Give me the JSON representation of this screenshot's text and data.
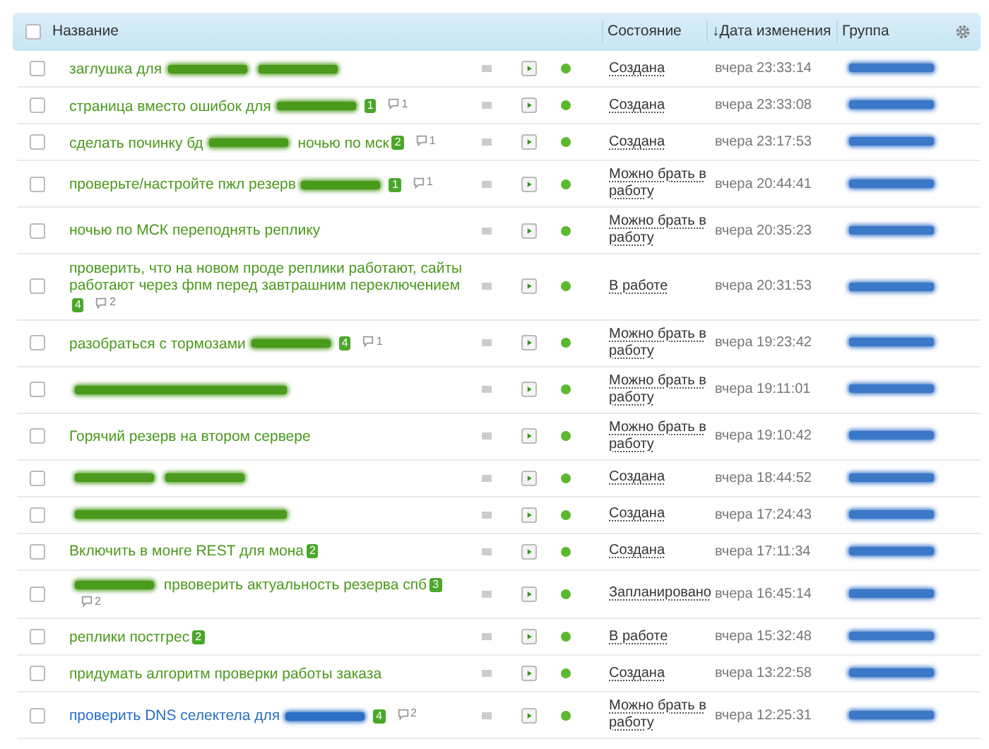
{
  "header": {
    "select_all_checked": false,
    "columns": [
      {
        "kind": "title",
        "label": "Название"
      },
      {
        "kind": "status",
        "label": "Состояние"
      },
      {
        "kind": "date",
        "label": "↓Дата изменения"
      },
      {
        "kind": "group",
        "label": "Группа"
      }
    ]
  },
  "rows": [
    {
      "checked": false,
      "color": "#4a9a1c",
      "title": [
        {
          "kind": "text",
          "text": "заглушка для"
        },
        {
          "kind": "redacted"
        },
        {
          "kind": "redacted"
        }
      ],
      "status_dot": {
        "color": "#5cb82e"
      },
      "status": "Создана",
      "date": "вчера 23:33:14",
      "group": {
        "kind": "redacted"
      }
    },
    {
      "checked": false,
      "color": "#4a9a1c",
      "title": [
        {
          "kind": "text",
          "text": "страница вместо ошибок для"
        },
        {
          "kind": "redacted"
        }
      ],
      "badge": "1",
      "comments": "1",
      "status_dot": {
        "color": "#5cb82e"
      },
      "status": "Создана",
      "date": "вчера 23:33:08",
      "group": {
        "kind": "redacted"
      }
    },
    {
      "checked": false,
      "color": "#4a9a1c",
      "title": [
        {
          "kind": "text",
          "text": "сделать починку бд"
        },
        {
          "kind": "redacted"
        },
        {
          "kind": "text",
          "text": "ночью по мск"
        }
      ],
      "badge": "2",
      "comments": "1",
      "status_dot": {
        "color": "#5cb82e"
      },
      "status": "Создана",
      "date": "вчера 23:17:53",
      "group": {
        "kind": "redacted"
      }
    },
    {
      "checked": false,
      "color": "#4a9a1c",
      "title": [
        {
          "kind": "text",
          "text": "проверьте/настройте пжл резерв"
        },
        {
          "kind": "redacted"
        }
      ],
      "badge": "1",
      "comments": "1",
      "status_dot": {
        "color": "#5cb82e"
      },
      "status": "Можно брать в работу",
      "date": "вчера 20:44:41",
      "group": {
        "kind": "redacted"
      }
    },
    {
      "checked": false,
      "color": "#4a9a1c",
      "title": [
        {
          "kind": "text",
          "text": "ночью по МСК переподнять реплику"
        }
      ],
      "status_dot": {
        "color": "#5cb82e"
      },
      "status": "Можно брать в работу",
      "date": "вчера 20:35:23",
      "group": {
        "kind": "redacted"
      }
    },
    {
      "checked": false,
      "color": "#4a9a1c",
      "title": [
        {
          "kind": "text",
          "text": "проверить, что на новом проде реплики работают, сайты работают через фпм перед завтрашним переключением"
        }
      ],
      "badge": "4",
      "comments": "2",
      "status_dot": {
        "color": "#5cb82e"
      },
      "status": "В работе",
      "date": "вчера 20:31:53",
      "group": {
        "kind": "redacted"
      }
    },
    {
      "checked": false,
      "color": "#4a9a1c",
      "title": [
        {
          "kind": "text",
          "text": "разобраться с тормозами"
        },
        {
          "kind": "redacted"
        }
      ],
      "badge": "4",
      "comments": "1",
      "status_dot": {
        "color": "#5cb82e"
      },
      "status": "Можно брать в работу",
      "date": "вчера 19:23:42",
      "group": {
        "kind": "redacted"
      }
    },
    {
      "checked": false,
      "color": "#4a9a1c",
      "title": [
        {
          "kind": "redacted"
        }
      ],
      "status_dot": {
        "color": "#5cb82e"
      },
      "status": "Можно брать в работу",
      "date": "вчера 19:11:01",
      "group": {
        "kind": "redacted"
      }
    },
    {
      "checked": false,
      "color": "#4a9a1c",
      "title": [
        {
          "kind": "text",
          "text": "Горячий резерв на втором сервере"
        }
      ],
      "status_dot": {
        "color": "#5cb82e"
      },
      "status": "Можно брать в работу",
      "date": "вчера 19:10:42",
      "group": {
        "kind": "redacted"
      }
    },
    {
      "checked": false,
      "color": "#4a9a1c",
      "title": [
        {
          "kind": "redacted"
        },
        {
          "kind": "redacted"
        }
      ],
      "status_dot": {
        "color": "#5cb82e"
      },
      "status": "Создана",
      "date": "вчера 18:44:52",
      "group": {
        "kind": "redacted"
      }
    },
    {
      "checked": false,
      "color": "#4a9a1c",
      "title": [
        {
          "kind": "redacted"
        }
      ],
      "status_dot": {
        "color": "#5cb82e"
      },
      "status": "Создана",
      "date": "вчера 17:24:43",
      "group": {
        "kind": "redacted"
      }
    },
    {
      "checked": false,
      "color": "#4a9a1c",
      "title": [
        {
          "kind": "text",
          "text": "Включить в монге REST для мона"
        }
      ],
      "badge": "2",
      "status_dot": {
        "color": "#5cb82e"
      },
      "status": "Создана",
      "date": "вчера 17:11:34",
      "group": {
        "kind": "redacted"
      }
    },
    {
      "checked": false,
      "color": "#4a9a1c",
      "title": [
        {
          "kind": "redacted"
        },
        {
          "kind": "text",
          "text": "првоверить актуальность резерва спб"
        }
      ],
      "badge": "3",
      "comments": "2",
      "status_dot": {
        "color": "#5cb82e"
      },
      "status": "Запланировано",
      "date": "вчера 16:45:14",
      "group": {
        "kind": "redacted"
      }
    },
    {
      "checked": false,
      "color": "#4a9a1c",
      "title": [
        {
          "kind": "text",
          "text": "реплики постгрес"
        }
      ],
      "badge": "2",
      "status_dot": {
        "color": "#5cb82e"
      },
      "status": "В работе",
      "date": "вчера 15:32:48",
      "group": {
        "kind": "redacted"
      }
    },
    {
      "checked": false,
      "color": "#4a9a1c",
      "title": [
        {
          "kind": "text",
          "text": "придумать алгоритм проверки работы заказа"
        }
      ],
      "status_dot": {
        "color": "#5cb82e"
      },
      "status": "Создана",
      "date": "вчера 13:22:58",
      "group": {
        "kind": "redacted"
      }
    },
    {
      "checked": false,
      "color": "#2a6fc4",
      "title": [
        {
          "kind": "text",
          "text": "проверить DNS селектела для"
        },
        {
          "kind": "redacted"
        }
      ],
      "badge": "4",
      "comments": "2",
      "status_dot": {
        "color": "#5cb82e"
      },
      "status": "Можно брать в работу",
      "date": "вчера 12:25:31",
      "group": {
        "kind": "redacted"
      }
    }
  ]
}
